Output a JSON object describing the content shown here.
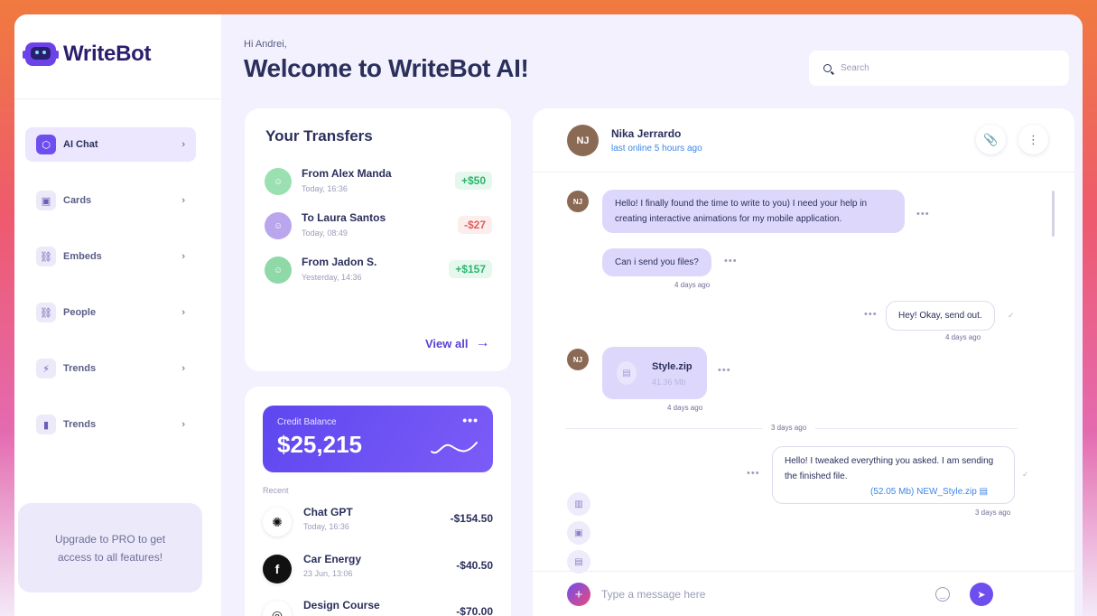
{
  "app": {
    "logo_text": "WriteBot"
  },
  "sidebar": {
    "items": [
      {
        "label": "AI Chat",
        "icon": "chat-icon",
        "active": true
      },
      {
        "label": "Cards",
        "icon": "image-icon"
      },
      {
        "label": "Embeds",
        "icon": "link-icon"
      },
      {
        "label": "People",
        "icon": "link-icon"
      },
      {
        "label": "Trends",
        "icon": "bolt-icon"
      },
      {
        "label": "Trends",
        "icon": "bar-chart-icon"
      }
    ],
    "upgrade_text": "Upgrade to PRO to get access to all features!"
  },
  "header": {
    "greeting": "Hi Andrei,",
    "title": "Welcome to WriteBot AI!",
    "search_placeholder": "Search"
  },
  "transfers": {
    "title": "Your Transfers",
    "items": [
      {
        "name": "From Alex Manda",
        "time": "Today, 16:36",
        "amount": "+$50",
        "type": "positive",
        "avatar_color": "#9be0b0"
      },
      {
        "name": "To Laura Santos",
        "time": "Today, 08:49",
        "amount": "-$27",
        "type": "negative",
        "avatar_color": "#b9a6ec"
      },
      {
        "name": "From Jadon S.",
        "time": "Yesterday, 14:36",
        "amount": "+$157",
        "type": "positive",
        "avatar_color": "#8fd8a8"
      }
    ],
    "view_all": "View all"
  },
  "balance": {
    "label": "Credit Balance",
    "amount": "$25,215",
    "recent_label": "Recent",
    "items": [
      {
        "name": "Chat GPT",
        "time": "Today, 16:36",
        "amount": "-$154.50",
        "icon": "openai-icon"
      },
      {
        "name": "Car Energy",
        "time": "23 Jun, 13:06",
        "amount": "-$40.50",
        "icon": "facebook-icon"
      },
      {
        "name": "Design Course",
        "time": "",
        "amount": "-$70.00",
        "icon": "instagram-icon"
      }
    ]
  },
  "chat": {
    "contact_name": "Nika Jerrardo",
    "contact_status": "last online 5 hours ago",
    "messages": {
      "m1": "Hello! I finally found the time to write to you) I need your help in creating interactive animations for my mobile application.",
      "m2": "Can i send you files?",
      "m2_time": "4 days ago",
      "m3": "Hey! Okay, send out.",
      "m3_time": "4 days ago",
      "file_name": "Style.zip",
      "file_size": "41.36 Mb",
      "file_time": "4 days ago",
      "day_separator": "3 days ago",
      "m4": "Hello! I tweaked everything you asked. I am sending the finished file.",
      "m4_attachment": "(52.05 Mb) NEW_Style.zip",
      "m4_time": "3 days ago"
    },
    "composer_placeholder": "Type a message here"
  }
}
